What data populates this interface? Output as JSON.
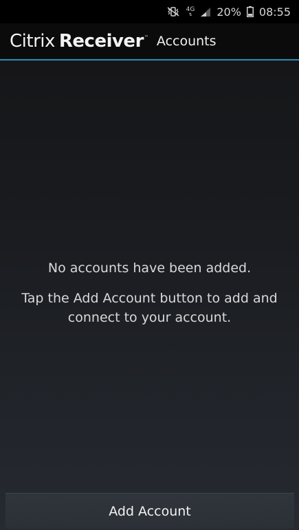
{
  "status_bar": {
    "network": "4G",
    "battery_percent": "20%",
    "time": "08:55",
    "icons": [
      "mute-vibrate-icon",
      "network-type-icon",
      "signal-icon",
      "battery-icon"
    ]
  },
  "app_bar": {
    "brand_primary": "Citrix",
    "brand_secondary": "Receiver",
    "brand_tm": "™",
    "title": "Accounts",
    "accent_color": "#2a8fb9"
  },
  "empty_state": {
    "message": "No accounts have been added.",
    "hint": "Tap the Add Account button to add and connect to your account."
  },
  "actions": {
    "add_account_label": "Add Account"
  }
}
